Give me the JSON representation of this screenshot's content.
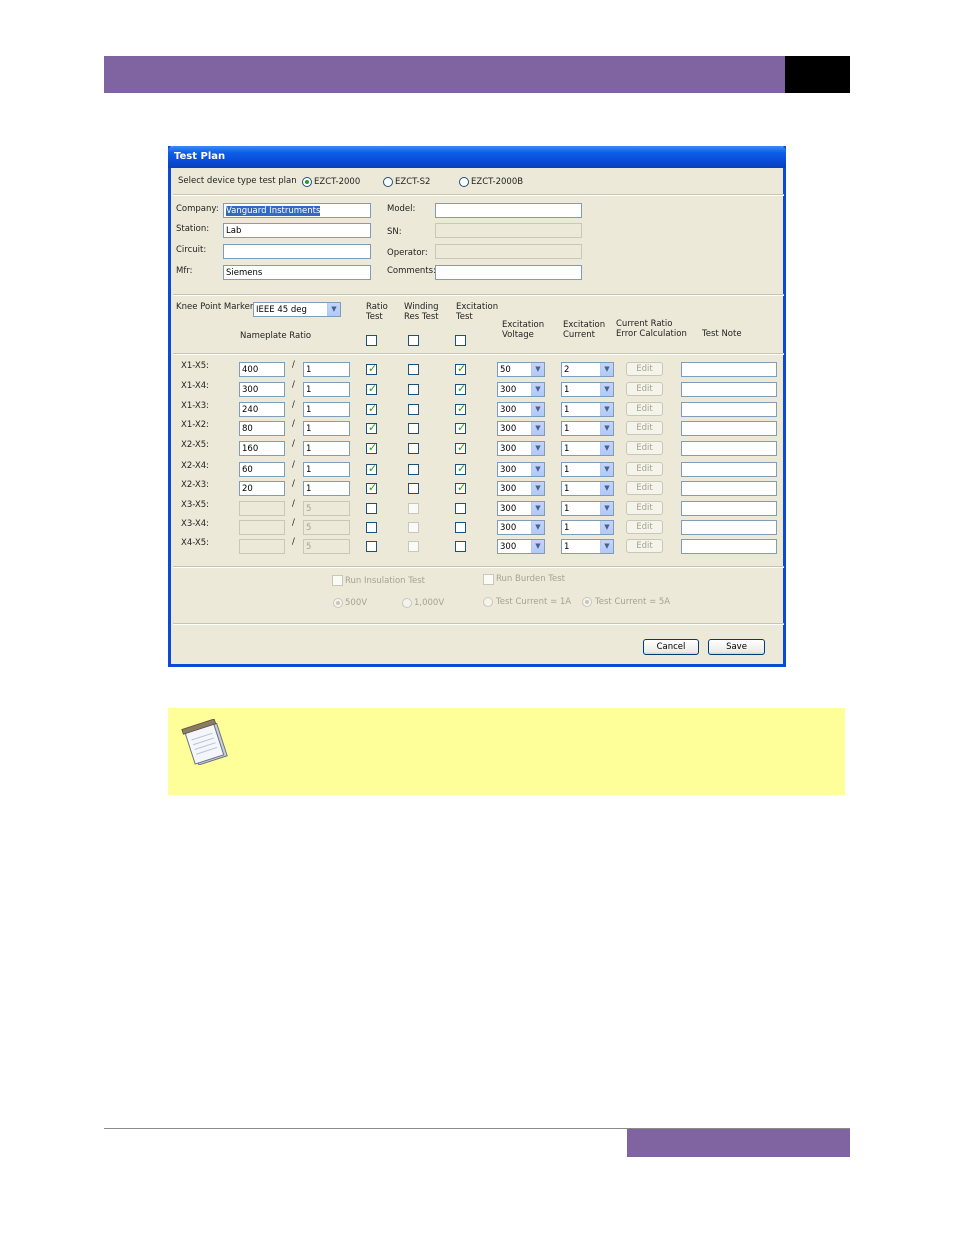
{
  "dialog": {
    "title": "Test Plan",
    "device_select_label": "Select device type test plan",
    "device_options": [
      {
        "label": "EZCT-2000",
        "selected": true
      },
      {
        "label": "EZCT-S2",
        "selected": false
      },
      {
        "label": "EZCT-2000B",
        "selected": false
      }
    ],
    "info": {
      "company_label": "Company:",
      "company_value": "Vanguard Instruments",
      "station_label": "Station:",
      "station_value": "Lab",
      "circuit_label": "Circuit:",
      "circuit_value": "",
      "mfr_label": "Mfr:",
      "mfr_value": "Siemens",
      "model_label": "Model:",
      "model_value": "",
      "sn_label": "SN:",
      "sn_value": "",
      "operator_label": "Operator:",
      "operator_value": "",
      "comments_label": "Comments:",
      "comments_value": ""
    },
    "knee_label": "Knee Point Marker:",
    "knee_value": "IEEE 45 deg",
    "headers": {
      "nameplate_ratio": "Nameplate Ratio",
      "ratio_test_1": "Ratio",
      "ratio_test_2": "Test",
      "winding_1": "Winding",
      "winding_2": "Res Test",
      "excitation_test_1": "Excitation",
      "excitation_test_2": "Test",
      "exc_voltage_1": "Excitation",
      "exc_voltage_2": "Voltage",
      "exc_current_1": "Excitation",
      "exc_current_2": "Current",
      "crec_1": "Current Ratio",
      "crec_2": "Error Calculation",
      "test_note": "Test Note"
    },
    "separator": "/",
    "edit_label": "Edit",
    "rows": [
      {
        "tap": "X1-X5:",
        "primary": "400",
        "secondary": "1",
        "ratio": true,
        "winding": false,
        "excitation": true,
        "voltage": "50",
        "current": "2",
        "enabled": true
      },
      {
        "tap": "X1-X4:",
        "primary": "300",
        "secondary": "1",
        "ratio": true,
        "winding": false,
        "excitation": true,
        "voltage": "300",
        "current": "1",
        "enabled": true
      },
      {
        "tap": "X1-X3:",
        "primary": "240",
        "secondary": "1",
        "ratio": true,
        "winding": false,
        "excitation": true,
        "voltage": "300",
        "current": "1",
        "enabled": true
      },
      {
        "tap": "X1-X2:",
        "primary": "80",
        "secondary": "1",
        "ratio": true,
        "winding": false,
        "excitation": true,
        "voltage": "300",
        "current": "1",
        "enabled": true
      },
      {
        "tap": "X2-X5:",
        "primary": "160",
        "secondary": "1",
        "ratio": true,
        "winding": false,
        "excitation": true,
        "voltage": "300",
        "current": "1",
        "enabled": true
      },
      {
        "tap": "X2-X4:",
        "primary": "60",
        "secondary": "1",
        "ratio": true,
        "winding": false,
        "excitation": true,
        "voltage": "300",
        "current": "1",
        "enabled": true
      },
      {
        "tap": "X2-X3:",
        "primary": "20",
        "secondary": "1",
        "ratio": true,
        "winding": false,
        "excitation": true,
        "voltage": "300",
        "current": "1",
        "enabled": true
      },
      {
        "tap": "X3-X5:",
        "primary": "",
        "secondary": "5",
        "ratio": false,
        "winding": false,
        "excitation": false,
        "voltage": "300",
        "current": "1",
        "enabled": false
      },
      {
        "tap": "X3-X4:",
        "primary": "",
        "secondary": "5",
        "ratio": false,
        "winding": false,
        "excitation": false,
        "voltage": "300",
        "current": "1",
        "enabled": false
      },
      {
        "tap": "X4-X5:",
        "primary": "",
        "secondary": "5",
        "ratio": false,
        "winding": false,
        "excitation": false,
        "voltage": "300",
        "current": "1",
        "enabled": false
      }
    ],
    "insulation": {
      "label": "Run Insulation Test",
      "opt1": "500V",
      "opt2": "1,000V"
    },
    "burden": {
      "label": "Run Burden Test",
      "opt1": "Test Current = 1A",
      "opt2": "Test Current = 5A"
    },
    "cancel_label": "Cancel",
    "save_label": "Save"
  },
  "colors": {
    "accent": "#8064a2",
    "note_bg": "#ffff99",
    "titlebar": "#0a4bd6"
  }
}
